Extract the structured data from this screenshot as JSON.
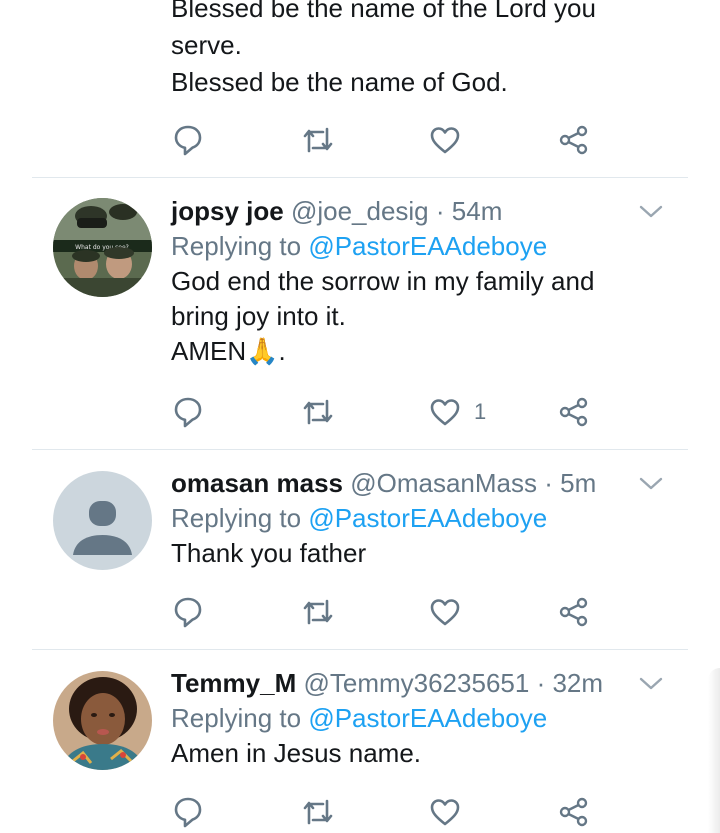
{
  "first_tweet": {
    "text_lines": [
      "Blessed be the name of the Lord you",
      "serve.",
      "Blessed be the name of God."
    ]
  },
  "tweets": [
    {
      "name": "jopsy joe",
      "handle": "@joe_desig",
      "time": "· 54m",
      "replying_prefix": "Replying to",
      "replying_to": "@PastorEAAdeboye",
      "text_lines": [
        "God end the sorrow in my family and",
        "bring joy into it.",
        "AMEN🙏."
      ],
      "like_count": "1",
      "avatar_caption": "What do you see?"
    },
    {
      "name": "omasan mass",
      "handle": "@OmasanMass",
      "time": "· 5m",
      "replying_prefix": "Replying to",
      "replying_to": "@PastorEAAdeboye",
      "text_lines": [
        "Thank you father"
      ],
      "like_count": ""
    },
    {
      "name": "Temmy_M",
      "handle": "@Temmy36235651",
      "time": "· 32m",
      "replying_prefix": "Replying to",
      "replying_to": "@PastorEAAdeboye",
      "text_lines": [
        "Amen in Jesus name."
      ],
      "like_count": ""
    }
  ],
  "icons": {
    "reply": "reply-icon",
    "retweet": "retweet-icon",
    "like": "heart-icon",
    "share": "share-icon",
    "menu": "chevron-down-icon"
  },
  "colors": {
    "icon_gray": "#657786",
    "link_blue": "#1da1f2",
    "divider": "#e1e8ed"
  }
}
